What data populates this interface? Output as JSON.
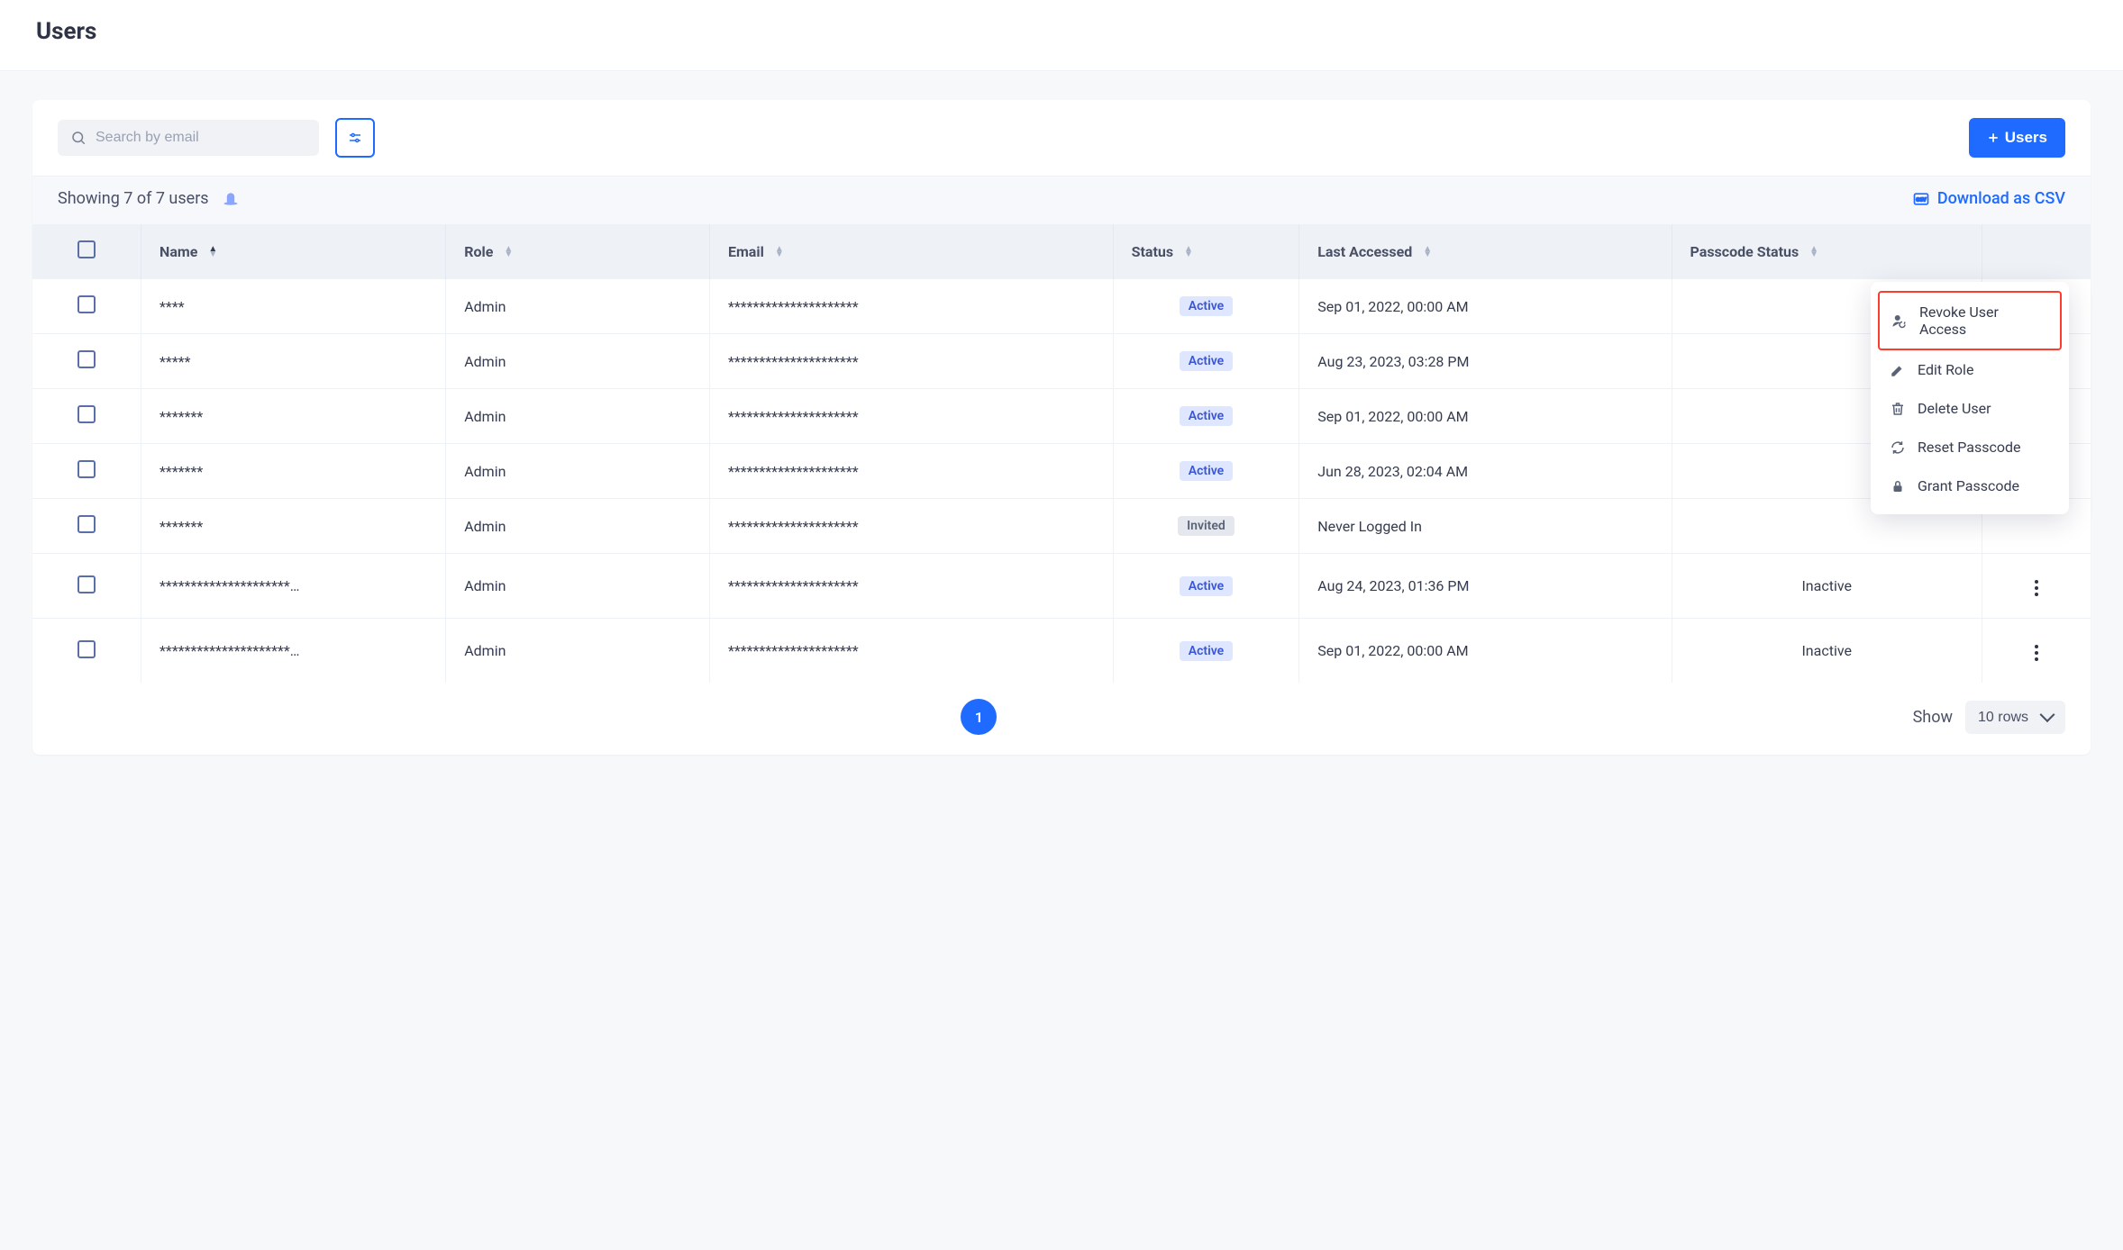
{
  "page": {
    "title": "Users"
  },
  "toolbar": {
    "search_placeholder": "Search by email",
    "add_users_label": "Users"
  },
  "status_bar": {
    "showing_text": "Showing 7 of 7 users",
    "download_label": "Download as CSV"
  },
  "columns": {
    "name": "Name",
    "role": "Role",
    "email": "Email",
    "status": "Status",
    "last_accessed": "Last Accessed",
    "passcode_status": "Passcode Status"
  },
  "rows": [
    {
      "name": "****",
      "role": "Admin",
      "email": "*********************",
      "status": "Active",
      "status_kind": "active",
      "last": "Sep 01, 2022, 00:00 AM",
      "pass": ""
    },
    {
      "name": "*****",
      "role": "Admin",
      "email": "*********************",
      "status": "Active",
      "status_kind": "active",
      "last": "Aug 23, 2023, 03:28 PM",
      "pass": ""
    },
    {
      "name": "*******",
      "role": "Admin",
      "email": "*********************",
      "status": "Active",
      "status_kind": "active",
      "last": "Sep 01, 2022, 00:00 AM",
      "pass": ""
    },
    {
      "name": "*******",
      "role": "Admin",
      "email": "*********************",
      "status": "Active",
      "status_kind": "active",
      "last": "Jun 28, 2023, 02:04 AM",
      "pass": ""
    },
    {
      "name": "*******",
      "role": "Admin",
      "email": "*********************",
      "status": "Invited",
      "status_kind": "invited",
      "last": "Never Logged In",
      "pass": ""
    },
    {
      "name": "*********************…",
      "role": "Admin",
      "email": "*********************",
      "status": "Active",
      "status_kind": "active",
      "last": "Aug 24, 2023, 01:36 PM",
      "pass": "Inactive"
    },
    {
      "name": "*********************…",
      "role": "Admin",
      "email": "*********************",
      "status": "Active",
      "status_kind": "active",
      "last": "Sep 01, 2022, 00:00 AM",
      "pass": "Inactive"
    }
  ],
  "dropdown": {
    "items": [
      {
        "label": "Revoke User Access",
        "icon": "user-revoke-icon",
        "highlight": true
      },
      {
        "label": "Edit Role",
        "icon": "pencil-icon",
        "highlight": false
      },
      {
        "label": "Delete User",
        "icon": "trash-icon",
        "highlight": false
      },
      {
        "label": "Reset Passcode",
        "icon": "refresh-icon",
        "highlight": false
      },
      {
        "label": "Grant Passcode",
        "icon": "lock-icon",
        "highlight": false
      }
    ]
  },
  "footer": {
    "current_page": "1",
    "show_label": "Show",
    "rows_selected": "10 rows"
  }
}
